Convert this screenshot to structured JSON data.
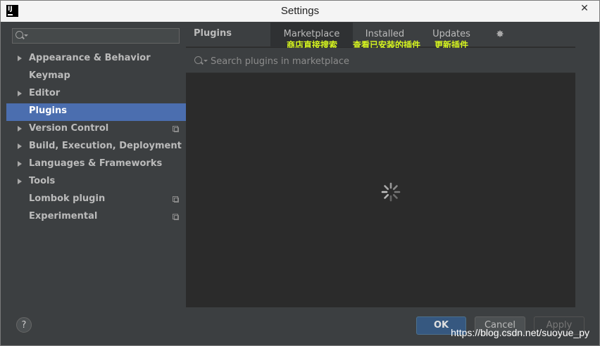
{
  "window": {
    "title": "Settings",
    "close_glyph": "✕",
    "app_icon_text": "IJ"
  },
  "sidebar": {
    "search": {
      "value": "",
      "placeholder": ""
    },
    "items": [
      {
        "label": "Appearance & Behavior",
        "expandable": true
      },
      {
        "label": "Keymap",
        "expandable": false
      },
      {
        "label": "Editor",
        "expandable": true
      },
      {
        "label": "Plugins",
        "expandable": false,
        "active": true
      },
      {
        "label": "Version Control",
        "expandable": true,
        "project_icon": true
      },
      {
        "label": "Build, Execution, Deployment",
        "expandable": true
      },
      {
        "label": "Languages & Frameworks",
        "expandable": true
      },
      {
        "label": "Tools",
        "expandable": true
      },
      {
        "label": "Lombok plugin",
        "expandable": false,
        "project_icon": true
      },
      {
        "label": "Experimental",
        "expandable": false,
        "project_icon": true
      }
    ]
  },
  "plugins": {
    "title": "Plugins",
    "tabs": [
      {
        "label": "Marketplace",
        "annotation": "商店直接搜索",
        "selected": true
      },
      {
        "label": "Installed",
        "annotation": "查看已安装的插件"
      },
      {
        "label": "Updates",
        "annotation": "更新插件"
      }
    ],
    "search": {
      "placeholder": "Search plugins in marketplace",
      "value": ""
    },
    "loading": true
  },
  "footer": {
    "help_label": "?",
    "ok_label": "OK",
    "cancel_label": "Cancel",
    "apply_label": "Apply",
    "watermark": "https://blog.csdn.net/suoyue_py"
  },
  "colors": {
    "accent": "#4b6eaf",
    "annotation": "#d6f51f",
    "panel": "#3c3f41",
    "content": "#2b2b2b"
  }
}
